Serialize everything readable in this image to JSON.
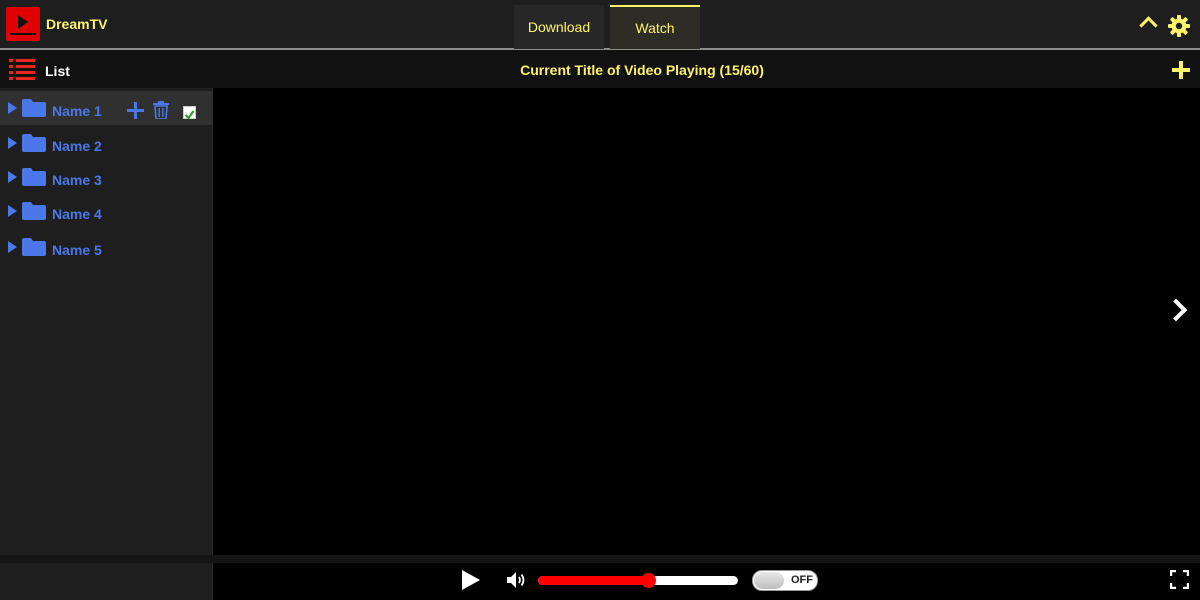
{
  "app": {
    "brand": "DreamTV"
  },
  "tabs": [
    {
      "label": "Download",
      "active": false
    },
    {
      "label": "Watch",
      "active": true
    }
  ],
  "header": {
    "collapse_icon": "chevron-up-icon",
    "settings_icon": "gear-icon"
  },
  "subheader": {
    "list_label": "List",
    "video_title": "Current Title of Video Playing (15/60)",
    "add_icon": "plus-icon"
  },
  "sidebar": {
    "folders": [
      {
        "name": "Name 1",
        "selected": true,
        "checked": true
      },
      {
        "name": "Name 2",
        "selected": false
      },
      {
        "name": "Name 3",
        "selected": false
      },
      {
        "name": "Name 4",
        "selected": false
      },
      {
        "name": "Name 5",
        "selected": false
      }
    ]
  },
  "player": {
    "volume_percent": 55,
    "toggle_label": "OFF"
  },
  "colors": {
    "accent": "#fff36a",
    "brand": "#e00000",
    "folder": "#4a78e8",
    "volume_fill": "#ff0000"
  }
}
